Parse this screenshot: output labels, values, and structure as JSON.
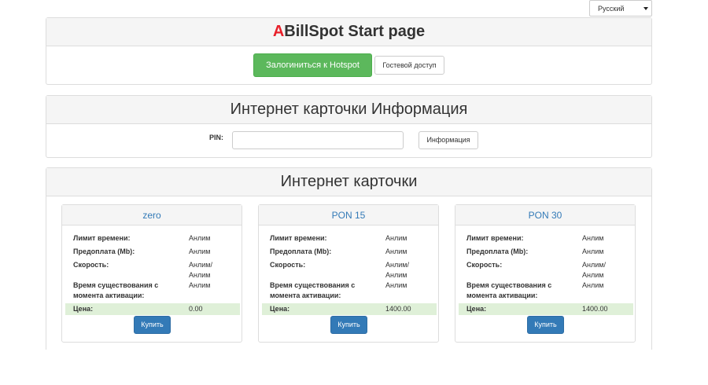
{
  "language": {
    "selected": "Русский"
  },
  "start_panel": {
    "title_accent": "A",
    "title_rest": "BillSpot Start page",
    "login_button": "Залогиниться к Hotspot",
    "guest_button": "Гостевой доступ"
  },
  "info_panel": {
    "title": "Интернет карточки Информация",
    "pin_label": "PIN:",
    "pin_value": "",
    "info_button": "Информация"
  },
  "cards_panel": {
    "title": "Интернет карточки",
    "labels": {
      "time_limit": "Лимит времени:",
      "prepaid": "Предоплата (Mb):",
      "speed": "Скорость:",
      "lifetime": "Время существования с момента активации:",
      "price": "Цена:"
    },
    "buy_label": "Купить",
    "cards": [
      {
        "name": "zero",
        "time_limit": "Анлим",
        "prepaid": "Анлим",
        "speed_line1": "Анлим/",
        "speed_line2": "Анлим",
        "lifetime": "Анлим",
        "price": "0.00"
      },
      {
        "name": "PON 15",
        "time_limit": "Анлим",
        "prepaid": "Анлим",
        "speed_line1": "Анлим/",
        "speed_line2": "Анлим",
        "lifetime": "Анлим",
        "price": "1400.00"
      },
      {
        "name": "PON 30",
        "time_limit": "Анлим",
        "prepaid": "Анлим",
        "speed_line1": "Анлим/",
        "speed_line2": "Анлим",
        "lifetime": "Анлим",
        "price": "1400.00"
      }
    ]
  }
}
